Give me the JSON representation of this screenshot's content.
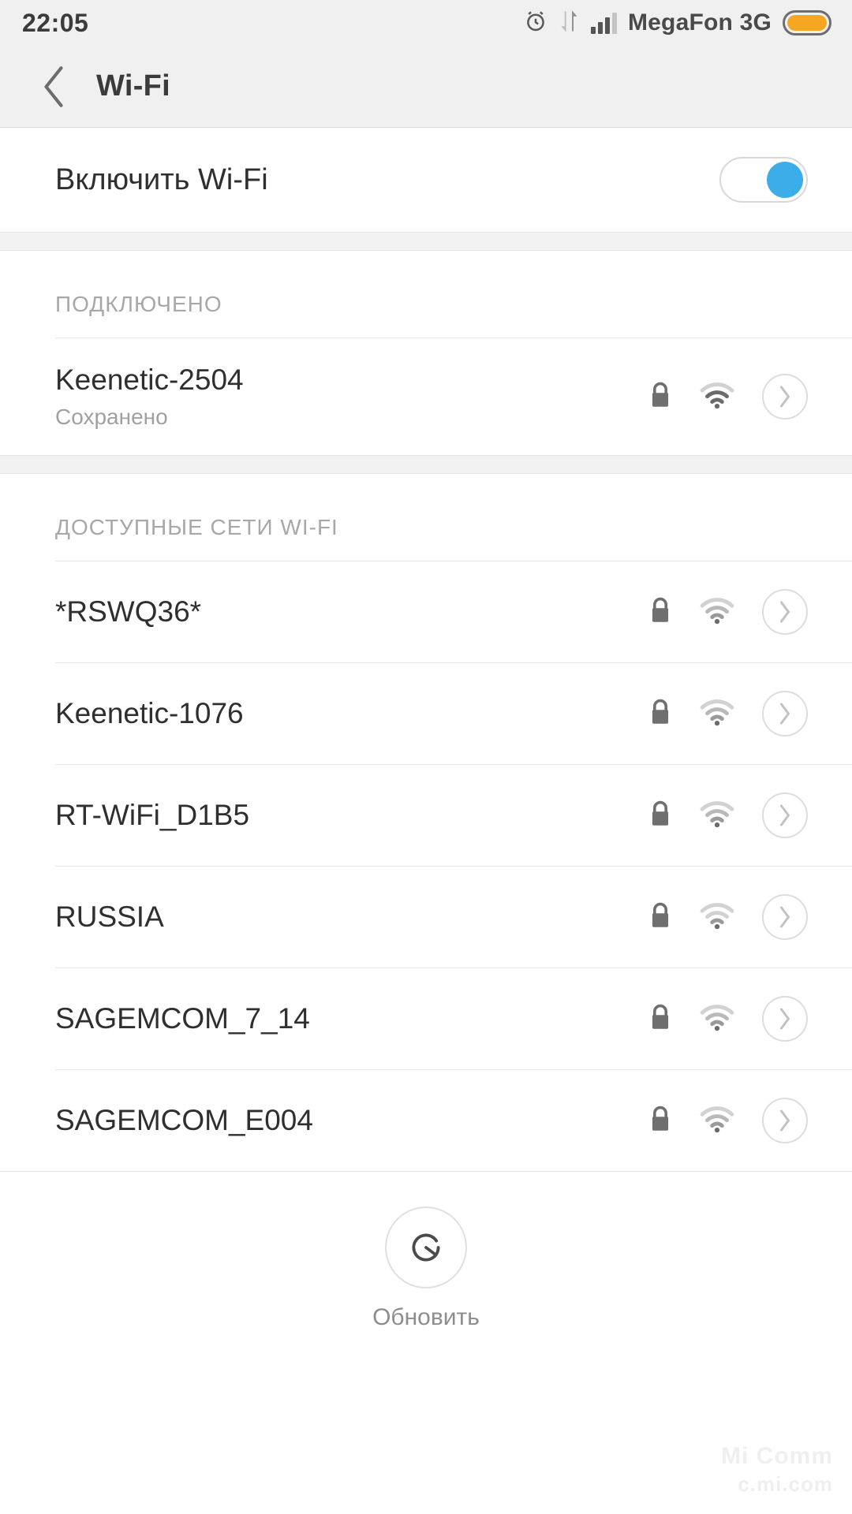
{
  "status_bar": {
    "time": "22:05",
    "carrier": "MegaFon 3G",
    "icons": [
      "alarm-icon",
      "data-transfer-icon",
      "signal-bars-icon",
      "battery-icon"
    ],
    "battery_color": "#f5a623"
  },
  "header": {
    "title": "Wi-Fi",
    "back_label": "back-arrow"
  },
  "wifi_toggle": {
    "label": "Включить Wi-Fi",
    "state": "on",
    "accent_color": "#3cade9"
  },
  "connected_section": {
    "title": "ПОДКЛЮЧЕНО",
    "networks": [
      {
        "ssid": "Keenetic-2504",
        "status": "Сохранено",
        "secured": true,
        "signal": 3
      }
    ]
  },
  "available_section": {
    "title": "ДОСТУПНЫЕ СЕТИ WI-FI",
    "networks": [
      {
        "ssid": "*RSWQ36*",
        "secured": true,
        "signal": 2
      },
      {
        "ssid": "Keenetic-1076",
        "secured": true,
        "signal": 2
      },
      {
        "ssid": "RT-WiFi_D1B5",
        "secured": true,
        "signal": 2
      },
      {
        "ssid": "RUSSIA",
        "secured": true,
        "signal": 1
      },
      {
        "ssid": "SAGEMCOM_7_14",
        "secured": true,
        "signal": 2
      },
      {
        "ssid": "SAGEMCOM_E004",
        "secured": true,
        "signal": 2
      }
    ]
  },
  "footer": {
    "refresh_label": "Обновить",
    "refresh_icon": "refresh-scan-icon"
  },
  "watermark": {
    "line1": "Mi Comm",
    "line2": "c.mi.com"
  }
}
